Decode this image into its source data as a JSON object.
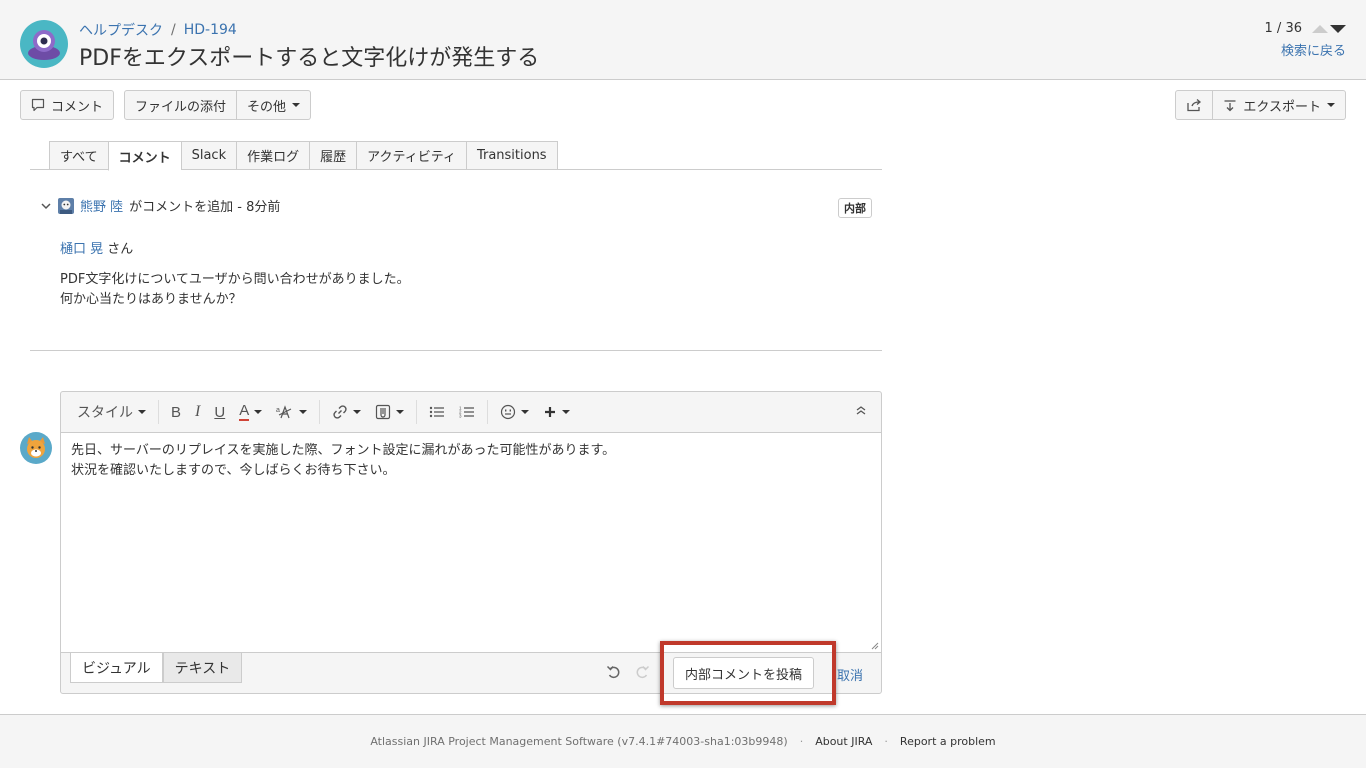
{
  "header": {
    "breadcrumb_project": "ヘルプデスク",
    "breadcrumb_separator": "/",
    "breadcrumb_issue": "HD-194",
    "summary": "PDFをエクスポートすると文字化けが発生する",
    "pager_text": "1 / 36",
    "back_to_search": "検索に戻る"
  },
  "toolbar": {
    "comment_label": "コメント",
    "attach_label": "ファイルの添付",
    "more_label": "その他",
    "export_label": "エクスポート"
  },
  "tabs": [
    {
      "label": "すべて"
    },
    {
      "label": "コメント"
    },
    {
      "label": "Slack"
    },
    {
      "label": "作業ログ"
    },
    {
      "label": "履歴"
    },
    {
      "label": "アクティビティ"
    },
    {
      "label": "Transitions"
    }
  ],
  "comment": {
    "author": "熊野 陸",
    "action": "がコメントを追加 - 8分前",
    "badge": "内部",
    "mention": "樋口 晃",
    "mention_suffix": "さん",
    "line1": "PDF文字化けについてユーザから問い合わせがありました。",
    "line2": "何か心当たりはありませんか？"
  },
  "editor": {
    "style_label": "スタイル",
    "bold": "B",
    "italic": "I",
    "underline": "U",
    "text_color": "A",
    "text_line1": "先日、サーバーのリプレイスを実施した際、フォント設定に漏れがあった可能性があります。",
    "text_line2": "状況を確認いたしますので、今しばらくお待ち下さい。",
    "mode_visual": "ビジュアル",
    "mode_text": "テキスト",
    "submit_label": "内部コメントを投稿",
    "cancel_label": "取消"
  },
  "footer": {
    "software": "Atlassian JIRA Project Management Software (v7.4.1#74003-sha1:03b9948)",
    "about": "About JIRA",
    "report": "Report a problem",
    "separator": "·"
  },
  "colors": {
    "link": "#3b73af",
    "highlight": "#c0392b",
    "text_color_underline": "#d04437",
    "avatar_teal": "#4ab7c4",
    "avatar_purple": "#6e4ca6"
  }
}
